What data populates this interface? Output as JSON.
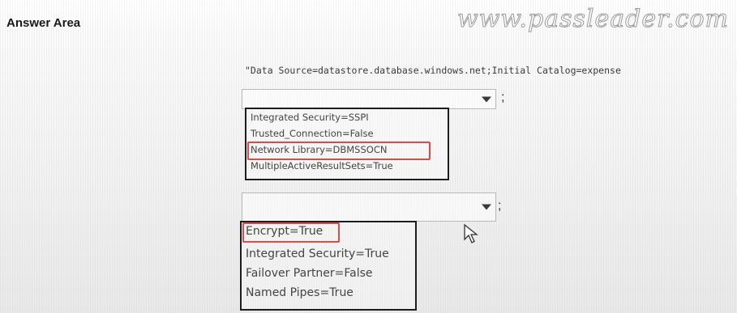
{
  "header": {
    "title": "Answer Area",
    "watermark": "www.passleader.com"
  },
  "connection_string": "\"Data Source=datastore.database.windows.net;Initial Catalog=expense",
  "separator": ";",
  "dropdown1": {
    "selected": "",
    "options": [
      "Integrated Security=SSPI",
      "Trusted_Connection=False",
      "Network Library=DBMSSOCN",
      "MultipleActiveResultSets=True"
    ],
    "highlighted_option": "Network Library=DBMSSOCN"
  },
  "dropdown2": {
    "selected": "",
    "options": [
      "Encrypt=True",
      "Integrated Security=True",
      "Failover Partner=False",
      "Named Pipes=True"
    ],
    "highlighted_option": "Encrypt=True"
  },
  "colors": {
    "highlight": "#dd4a4a",
    "list_border": "#1c1c1c"
  },
  "icons": {
    "caret": "chevron-down-icon",
    "pointer": "mouse-pointer-icon"
  }
}
